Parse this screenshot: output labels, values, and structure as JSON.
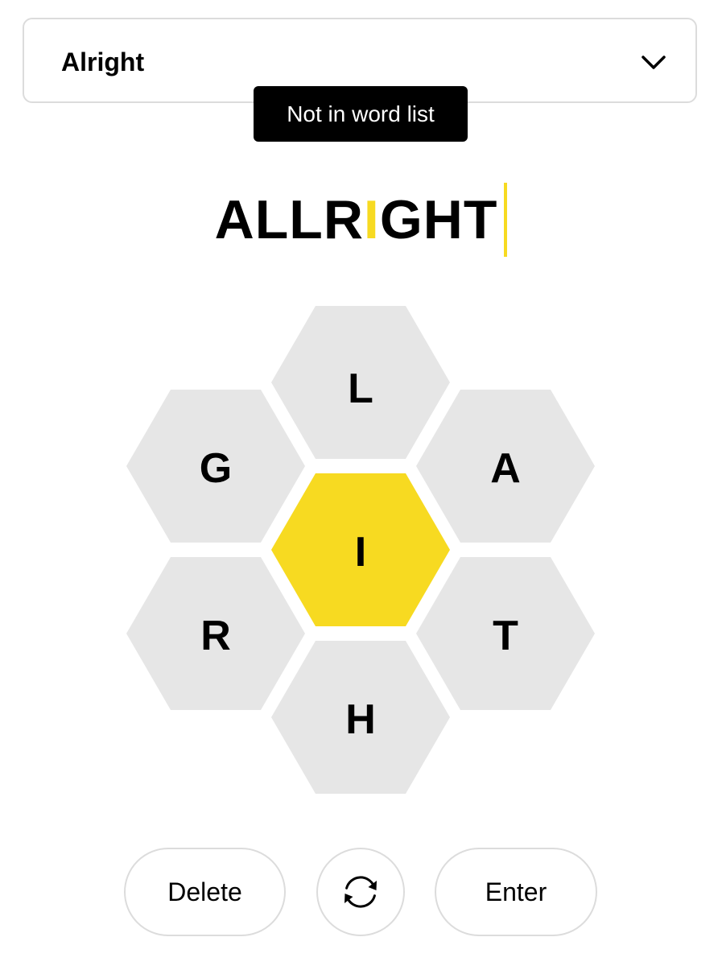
{
  "dropdown": {
    "label": "Alright",
    "icon": "chevron-down-icon"
  },
  "toast": {
    "message": "Not in word list"
  },
  "input": {
    "letters": [
      "A",
      "L",
      "L",
      "R",
      "I",
      "G",
      "H",
      "T"
    ],
    "center_letter": "I"
  },
  "hive": {
    "center": "I",
    "top": "L",
    "upper_right": "A",
    "lower_right": "T",
    "bottom": "H",
    "lower_left": "R",
    "upper_left": "G"
  },
  "buttons": {
    "delete_label": "Delete",
    "shuffle_icon": "shuffle-icon",
    "enter_label": "Enter"
  },
  "colors": {
    "center_cell": "#f7da21",
    "outer_cell": "#e6e6e6",
    "border": "#dcdcdc",
    "toast_bg": "#000000"
  }
}
